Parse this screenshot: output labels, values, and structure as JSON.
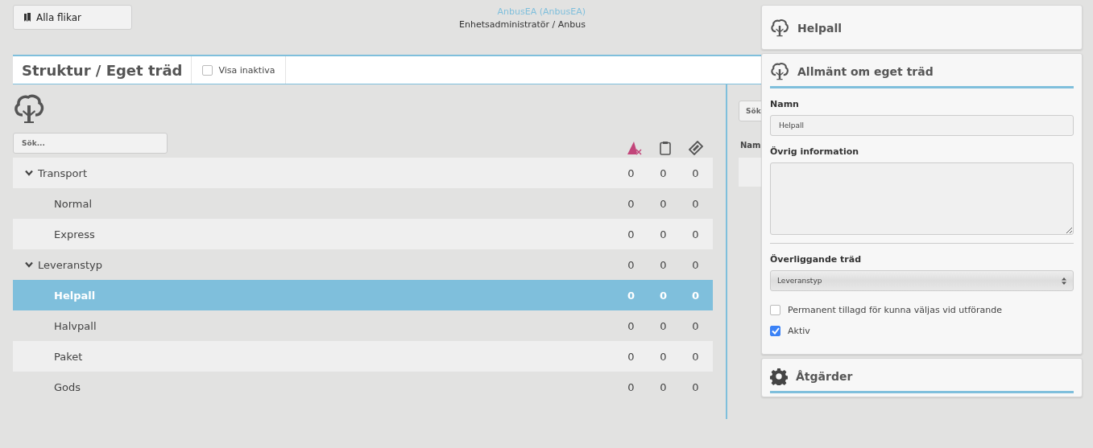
{
  "top_bar": {
    "tabs_button": "Alla flikar",
    "user_name": "AnbusEA (AnbusEA)",
    "user_role": "Enhetsadministratör / Anbus"
  },
  "page_header": {
    "title": "Struktur / Eget träd",
    "show_inactive": {
      "label": "Visa inaktiva",
      "checked": false
    }
  },
  "tree": {
    "search": {
      "placeholder": "Sök..."
    },
    "nodes": [
      {
        "label": "Transport",
        "expanded": true,
        "selected": false,
        "counts": [
          "0",
          "0",
          "0"
        ],
        "children": [
          {
            "label": "Normal",
            "selected": false,
            "counts": [
              "0",
              "0",
              "0"
            ]
          },
          {
            "label": "Express",
            "selected": false,
            "counts": [
              "0",
              "0",
              "0"
            ]
          }
        ]
      },
      {
        "label": "Leveranstyp",
        "expanded": true,
        "selected": false,
        "counts": [
          "0",
          "0",
          "0"
        ],
        "children": [
          {
            "label": "Helpall",
            "selected": true,
            "counts": [
              "0",
              "0",
              "0"
            ]
          },
          {
            "label": "Halvpall",
            "selected": false,
            "counts": [
              "0",
              "0",
              "0"
            ]
          },
          {
            "label": "Paket",
            "selected": false,
            "counts": [
              "0",
              "0",
              "0"
            ]
          },
          {
            "label": "Gods",
            "selected": false,
            "counts": [
              "0",
              "0",
              "0"
            ]
          }
        ]
      }
    ]
  },
  "middle_panel": {
    "search": {
      "placeholder": "Sök"
    },
    "column_1": "Nam"
  },
  "detail": {
    "title": "Helpall",
    "general": {
      "heading": "Allmänt om eget träd",
      "name_label": "Namn",
      "name_value": "Helpall",
      "info_label": "Övrig information",
      "parent_label": "Överliggande träd",
      "parent_value": "Leveranstyp",
      "checkboxes": [
        {
          "label": "Permanent tillagd för kunna väljas vid utförande",
          "checked": false
        },
        {
          "label": "Aktiv",
          "checked": true
        }
      ]
    },
    "actions": {
      "heading": "Åtgärder"
    }
  }
}
